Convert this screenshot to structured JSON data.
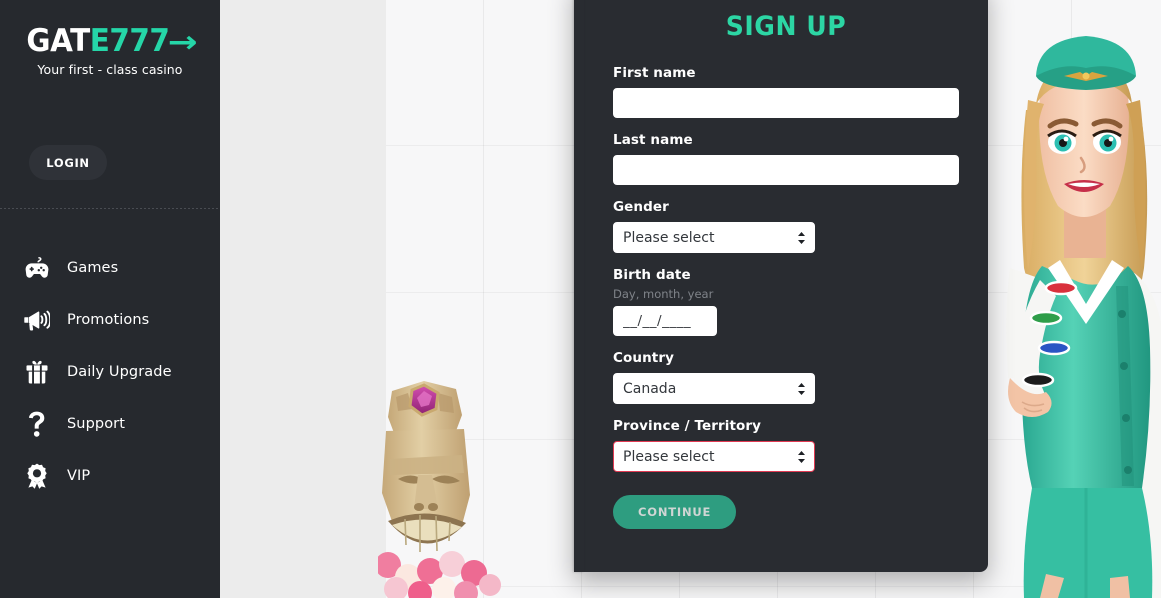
{
  "brand": {
    "logo_part_white": "GAT",
    "logo_part_teal": "E777",
    "logo_arrow": "→",
    "tagline": "Your first - class casino",
    "accent_color": "#25d6a8",
    "sidebar_color": "#26292e",
    "modal_color": "#292c31",
    "error_color": "#e03a52"
  },
  "sidebar": {
    "login_label": "LOGIN",
    "items": [
      {
        "label": "Games",
        "icon": "gamepad-icon"
      },
      {
        "label": "Promotions",
        "icon": "megaphone-icon"
      },
      {
        "label": "Daily Upgrade",
        "icon": "gift-icon"
      },
      {
        "label": "Support",
        "icon": "question-mark-icon"
      },
      {
        "label": "VIP",
        "icon": "award-ribbon-icon"
      }
    ]
  },
  "modal": {
    "title": "SIGN UP",
    "fields": {
      "first_name": {
        "label": "First name",
        "value": "",
        "placeholder": ""
      },
      "last_name": {
        "label": "Last name",
        "value": "",
        "placeholder": ""
      },
      "gender": {
        "label": "Gender",
        "selected": "Please select"
      },
      "birth_date": {
        "label": "Birth date",
        "hint": "Day, month, year",
        "value": "__/__/____",
        "placeholder": "__/__/____"
      },
      "country": {
        "label": "Country",
        "selected": "Canada"
      },
      "province": {
        "label": "Province / Territory",
        "selected": "Please select",
        "has_error": true
      }
    },
    "submit_label": "CONTINUE"
  },
  "decor": {
    "tiki": "tiki-totem-mask",
    "hostess": "flight-attendant-character",
    "chips": [
      "red",
      "green",
      "blue",
      "black"
    ]
  }
}
